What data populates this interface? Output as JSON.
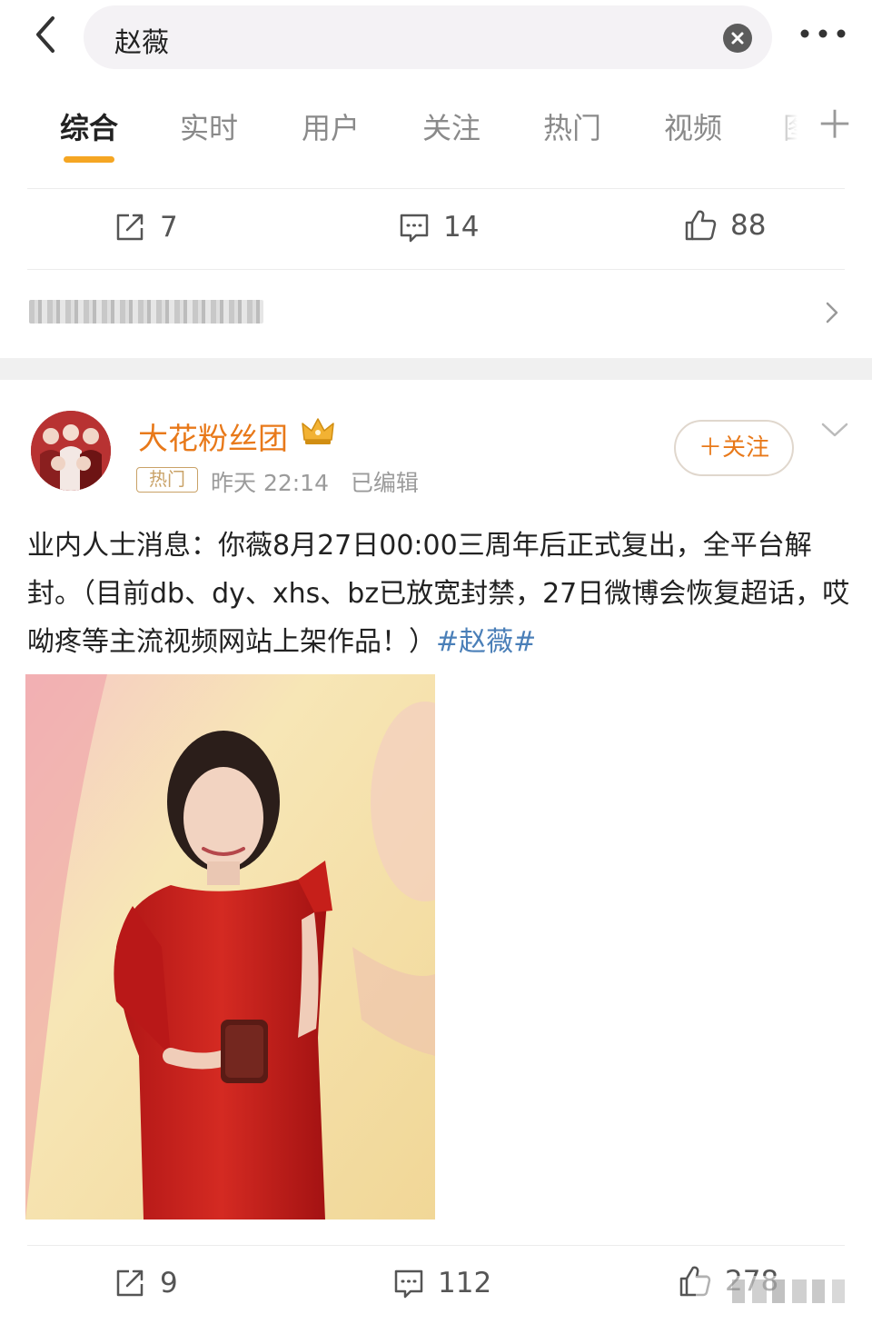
{
  "search": {
    "query": "赵薇"
  },
  "tabs": [
    {
      "label": "综合",
      "active": true
    },
    {
      "label": "实时",
      "active": false
    },
    {
      "label": "用户",
      "active": false
    },
    {
      "label": "关注",
      "active": false
    },
    {
      "label": "热门",
      "active": false
    },
    {
      "label": "视频",
      "active": false
    },
    {
      "label": "图",
      "active": false
    }
  ],
  "prev_post": {
    "reposts": "7",
    "comments": "14",
    "likes": "88"
  },
  "post": {
    "author": "大花粉丝团",
    "badge": "热门",
    "meta": "昨天 22:14   已编辑",
    "follow_label": "＋关注",
    "text": "业内人士消息：你薇8月27日00:00三周年后正式复出，全平台解封。（目前db、dy、xhs、bz已放宽封禁，27日微博会恢复超话，哎呦疼等主流视频网站上架作品！）",
    "hashtag": "#赵薇#",
    "reposts": "9",
    "comments": "112",
    "likes": "278"
  },
  "colors": {
    "accent_orange": "#f5a623",
    "username_orange": "#e8791a",
    "hashtag_blue": "#4a7fb8",
    "badge_gold": "#c9a267"
  }
}
